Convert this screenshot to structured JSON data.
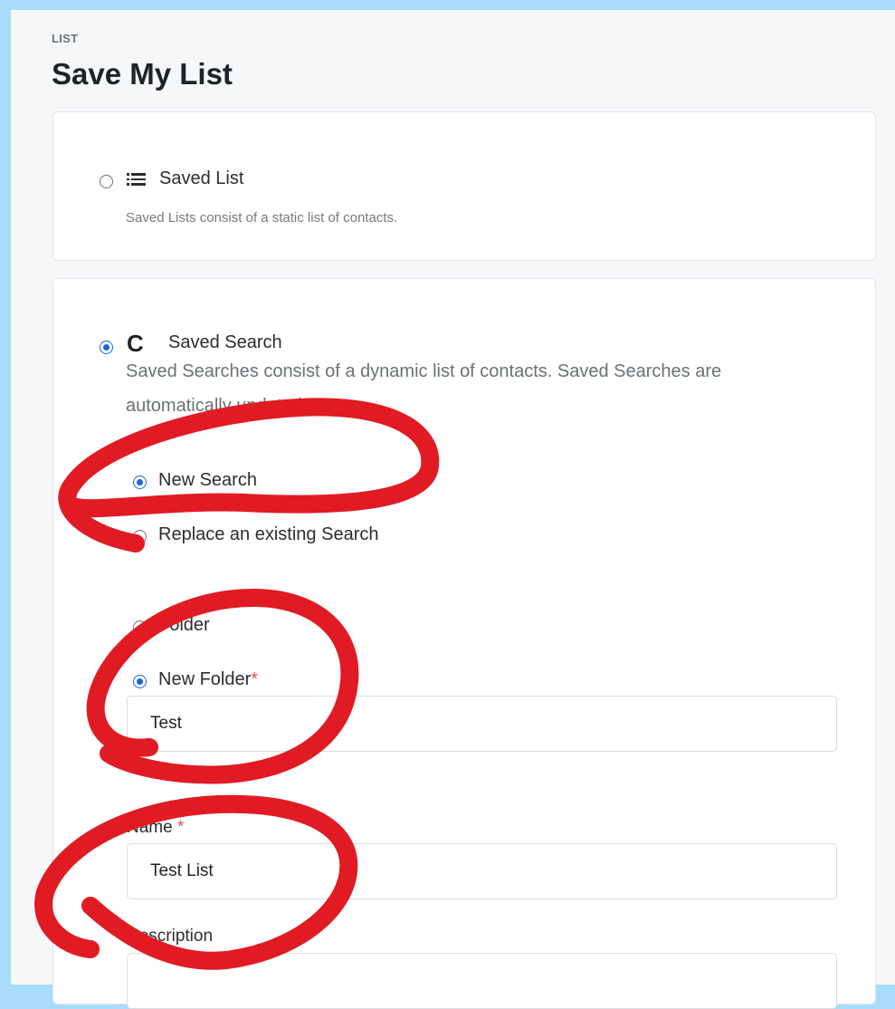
{
  "header": {
    "eyebrow": "LIST",
    "title": "Save My List"
  },
  "list_type": {
    "saved_list": {
      "label": "Saved List",
      "description": "Saved Lists consist of a static list of contacts.",
      "icon": "list-icon",
      "selected": false
    },
    "saved_search": {
      "label": "Saved Search",
      "description": "Saved Searches consist of a dynamic list of contacts. Saved Searches are automatically updated.",
      "icon": "refresh-icon",
      "selected": true
    }
  },
  "search_mode": {
    "options": [
      {
        "label": "New Search",
        "selected": true
      },
      {
        "label": "Replace an existing Search",
        "selected": false
      }
    ]
  },
  "folder": {
    "existing_label": "Folder",
    "new_label": "New Folder",
    "new_required_mark": "*",
    "new_value": "Test",
    "new_selected": true
  },
  "name": {
    "label": "Name",
    "required_mark": "*",
    "value": "Test List"
  },
  "description_field": {
    "label": "Description",
    "value": ""
  },
  "colors": {
    "accent": "#1a66e0",
    "annotation": "#e01b24",
    "background": "#a9dcfb"
  }
}
